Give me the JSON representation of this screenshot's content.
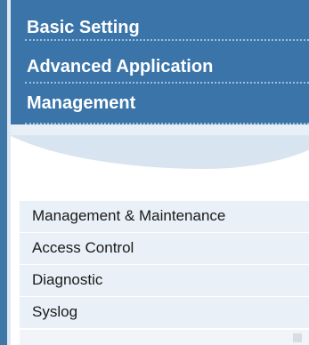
{
  "nav": {
    "items": [
      {
        "label": "Basic Setting"
      },
      {
        "label": "Advanced Application"
      },
      {
        "label": "Management"
      }
    ]
  },
  "submenu": {
    "items": [
      {
        "label": "Management & Maintenance"
      },
      {
        "label": "Access Control"
      },
      {
        "label": "Diagnostic"
      },
      {
        "label": "Syslog"
      }
    ]
  },
  "colors": {
    "nav_background": "#3a74a8",
    "nav_text": "#ffffff",
    "submenu_background": "#e9f0f7",
    "submenu_text": "#1a1a1a"
  }
}
